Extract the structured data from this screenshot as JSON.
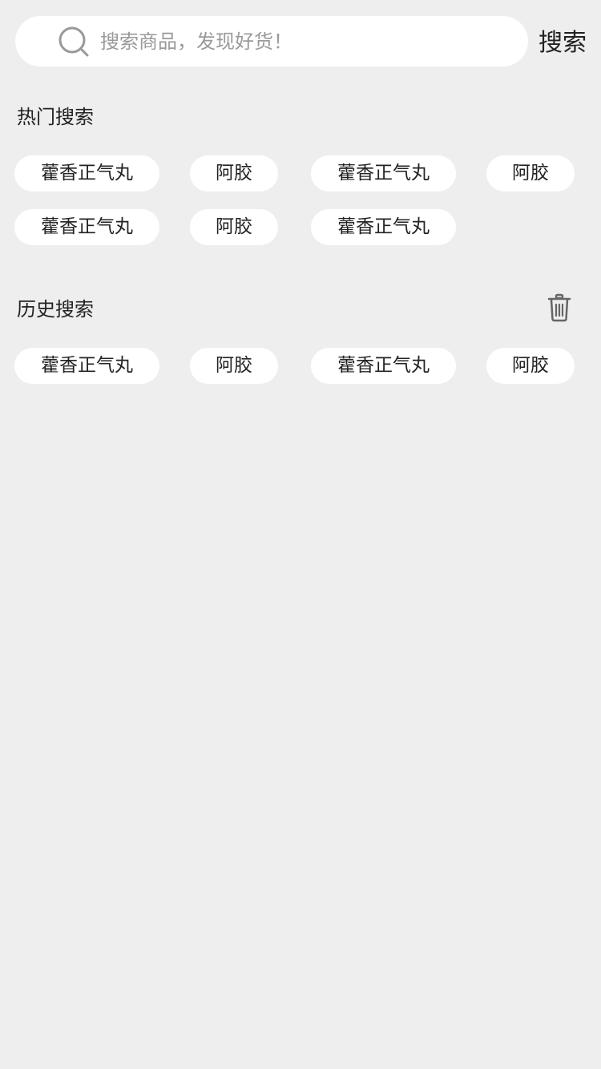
{
  "search": {
    "placeholder": "搜索商品，发现好货！",
    "button_label": "搜索"
  },
  "hot": {
    "title": "热门搜索",
    "tags": [
      "藿香正气丸",
      "阿胶",
      "藿香正气丸",
      "阿胶",
      "藿香正气丸",
      "阿胶",
      "藿香正气丸"
    ]
  },
  "history": {
    "title": "历史搜索",
    "tags": [
      "藿香正气丸",
      "阿胶",
      "藿香正气丸",
      "阿胶"
    ]
  },
  "icons": {
    "search": "search-icon",
    "clear_history": "trash-icon"
  },
  "colors": {
    "background": "#eeeeee",
    "tag_background": "#ffffff",
    "placeholder": "#9a9a9a",
    "text": "#222222"
  }
}
